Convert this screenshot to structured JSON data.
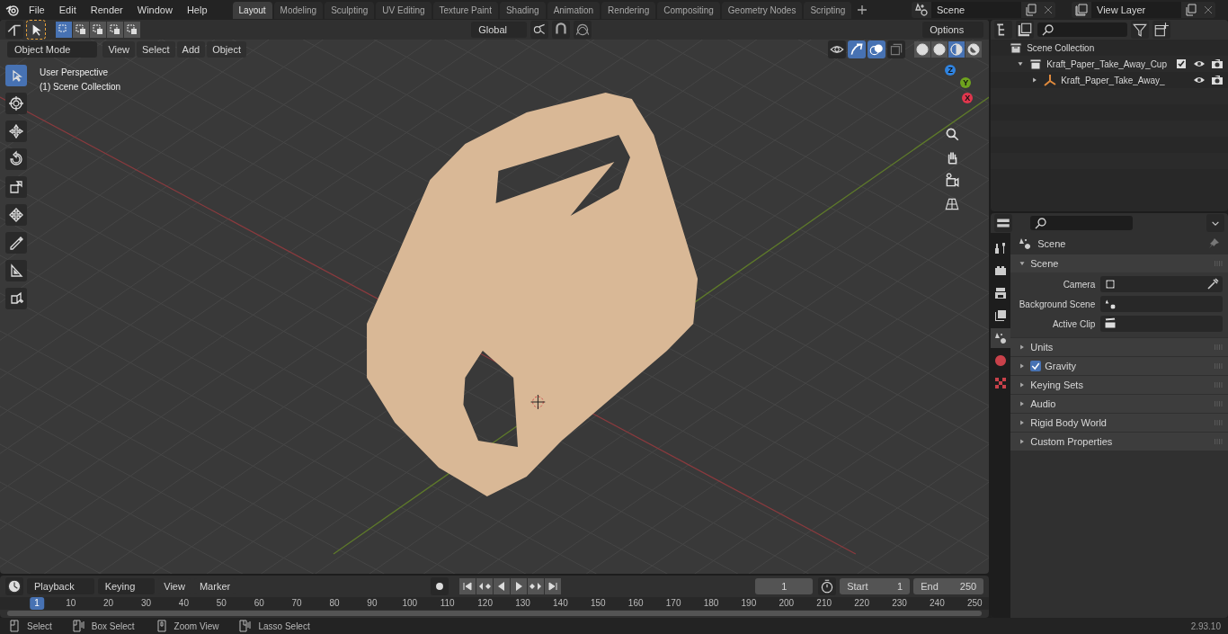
{
  "menu": [
    "File",
    "Edit",
    "Render",
    "Window",
    "Help"
  ],
  "workspace_tabs": [
    {
      "label": "Layout",
      "selected": true
    },
    {
      "label": "Modeling",
      "selected": false
    },
    {
      "label": "Sculpting",
      "selected": false
    },
    {
      "label": "UV Editing",
      "selected": false
    },
    {
      "label": "Texture Paint",
      "selected": false
    },
    {
      "label": "Shading",
      "selected": false
    },
    {
      "label": "Animation",
      "selected": false
    },
    {
      "label": "Rendering",
      "selected": false
    },
    {
      "label": "Compositing",
      "selected": false
    },
    {
      "label": "Geometry Nodes",
      "selected": false
    },
    {
      "label": "Scripting",
      "selected": false
    }
  ],
  "scene": {
    "value": "Scene"
  },
  "view_layer": {
    "value": "View Layer"
  },
  "viewport": {
    "transform_orientation": "Global",
    "options": "Options",
    "mode": "Object Mode",
    "menus": [
      "View",
      "Select",
      "Add",
      "Object"
    ],
    "info": [
      "User Perspective",
      "(1) Scene Collection"
    ],
    "select_modes": [
      {
        "kind": "new",
        "selected": true
      },
      {
        "kind": "extend",
        "selected": false
      },
      {
        "kind": "subtract",
        "selected": false
      },
      {
        "kind": "invert",
        "selected": false
      },
      {
        "kind": "intersect",
        "selected": false
      }
    ],
    "tools": [
      {
        "kind": "select",
        "selected": true
      },
      {
        "kind": "cursor",
        "selected": false
      },
      {
        "kind": "move",
        "selected": false
      },
      {
        "kind": "rotate",
        "selected": false
      },
      {
        "kind": "scale",
        "selected": false
      },
      {
        "kind": "transform",
        "selected": false
      },
      {
        "kind": "annotate",
        "selected": false
      },
      {
        "kind": "measure",
        "selected": false
      },
      {
        "kind": "add-cube",
        "selected": false
      }
    ],
    "shading_modes": [
      {
        "kind": "wireframe",
        "selected": false
      },
      {
        "kind": "solid",
        "selected": false
      },
      {
        "kind": "material",
        "selected": true
      },
      {
        "kind": "rendered",
        "selected": false
      }
    ],
    "gizmo_axes": [
      {
        "label": "Z",
        "color": "#2f83e0"
      },
      {
        "label": "Y",
        "color": "#6ea21e"
      },
      {
        "label": "X",
        "color": "#e0364d"
      }
    ]
  },
  "outliner": {
    "root": "Scene Collection",
    "items": [
      {
        "kind": "collection",
        "label": "Kraft_Paper_Take_Away_Cup",
        "expanded": true,
        "checked": true,
        "children": [
          {
            "kind": "object",
            "label": "Kraft_Paper_Take_Away_",
            "expanded": false
          }
        ]
      }
    ]
  },
  "properties": {
    "tabs": [
      {
        "kind": "tool",
        "selected": false
      },
      {
        "kind": "render",
        "selected": false
      },
      {
        "kind": "output",
        "selected": false
      },
      {
        "kind": "view-layer",
        "selected": false
      },
      {
        "kind": "scene",
        "selected": true
      },
      {
        "kind": "world",
        "selected": false
      },
      {
        "kind": "texture",
        "selected": false
      }
    ],
    "context": "Scene",
    "panels": [
      {
        "title": "Scene",
        "expanded": true,
        "fields": [
          {
            "label": "Camera",
            "kind": "camera"
          },
          {
            "label": "Background Scene",
            "kind": "scene"
          },
          {
            "label": "Active Clip",
            "kind": "clip"
          }
        ]
      },
      {
        "title": "Units",
        "expanded": false
      },
      {
        "title": "Gravity",
        "expanded": false,
        "kind": "toggle",
        "checked": true
      },
      {
        "title": "Keying Sets",
        "expanded": false
      },
      {
        "title": "Audio",
        "expanded": false
      },
      {
        "title": "Rigid Body World",
        "expanded": false
      },
      {
        "title": "Custom Properties",
        "expanded": false
      }
    ]
  },
  "timeline": {
    "menus": [
      "Playback",
      "Keying",
      "View",
      "Marker"
    ],
    "current_frame": "1",
    "start": {
      "label": "Start",
      "value": "1"
    },
    "end": {
      "label": "End",
      "value": "250"
    },
    "ruler": [
      {
        "label": "1",
        "selected": true
      },
      {
        "label": "10",
        "selected": false
      },
      {
        "label": "20",
        "selected": false
      },
      {
        "label": "30",
        "selected": false
      },
      {
        "label": "40",
        "selected": false
      },
      {
        "label": "50",
        "selected": false
      },
      {
        "label": "60",
        "selected": false
      },
      {
        "label": "70",
        "selected": false
      },
      {
        "label": "80",
        "selected": false
      },
      {
        "label": "90",
        "selected": false
      },
      {
        "label": "100",
        "selected": false
      },
      {
        "label": "110",
        "selected": false
      },
      {
        "label": "120",
        "selected": false
      },
      {
        "label": "130",
        "selected": false
      },
      {
        "label": "140",
        "selected": false
      },
      {
        "label": "150",
        "selected": false
      },
      {
        "label": "160",
        "selected": false
      },
      {
        "label": "170",
        "selected": false
      },
      {
        "label": "180",
        "selected": false
      },
      {
        "label": "190",
        "selected": false
      },
      {
        "label": "200",
        "selected": false
      },
      {
        "label": "210",
        "selected": false
      },
      {
        "label": "220",
        "selected": false
      },
      {
        "label": "230",
        "selected": false
      },
      {
        "label": "240",
        "selected": false
      },
      {
        "label": "250",
        "selected": false
      }
    ]
  },
  "status_bar": {
    "items": [
      {
        "kind": "left-click",
        "label": "Select"
      },
      {
        "kind": "left-drag",
        "label": "Box Select"
      },
      {
        "kind": "middle",
        "label": "Zoom View"
      },
      {
        "kind": "right-drag",
        "label": "Lasso Select"
      }
    ],
    "version": "2.93.10"
  }
}
